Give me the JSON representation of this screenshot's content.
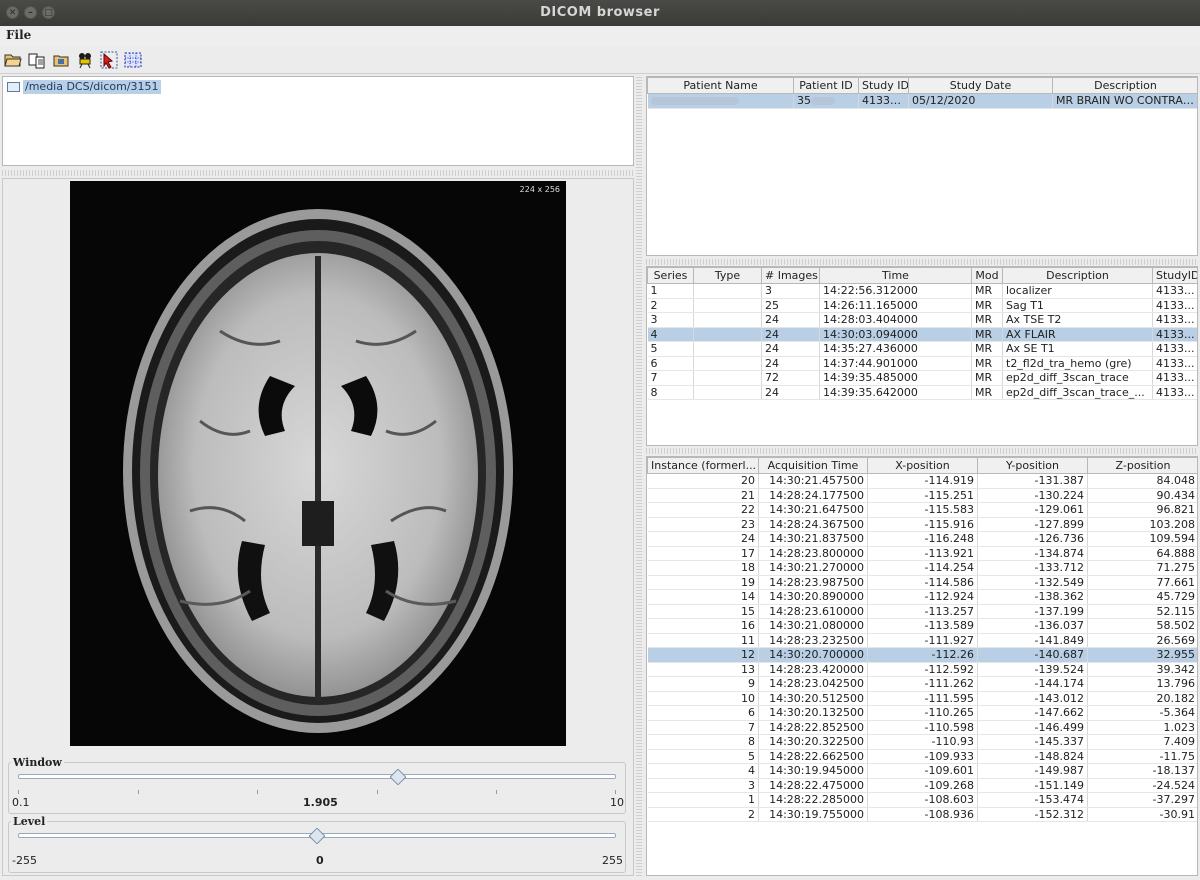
{
  "window": {
    "title": "DICOM browser"
  },
  "menu": {
    "file": "File"
  },
  "toolbar": {
    "icons": [
      "open-folder-icon",
      "copy-icon",
      "open-file-icon",
      "camera-icon",
      "select-icon",
      "select-region-icon"
    ]
  },
  "tree": {
    "path": "/media      DCS/dicom/3151"
  },
  "image": {
    "dims_label": "224 x 256"
  },
  "window_slider": {
    "label": "Window",
    "min": "0.1",
    "value": "1.905",
    "max": "10",
    "fraction": 0.635
  },
  "level_slider": {
    "label": "Level",
    "min": "-255",
    "value": "0",
    "max": "255",
    "fraction": 0.5
  },
  "patients": {
    "columns": [
      "Patient Name",
      "Patient ID",
      "Study ID",
      "Study Date",
      "Description"
    ],
    "rows": [
      [
        "",
        "35",
        "41331...",
        "05/12/2020",
        "MR BRAIN WO CONTRAST"
      ]
    ]
  },
  "series": {
    "columns": [
      "Series",
      "Type",
      "# Images",
      "Time",
      "Mod",
      "Description",
      "StudyID"
    ],
    "selected": 3,
    "rows": [
      [
        "1",
        "",
        "3",
        "14:22:56.312000",
        "MR",
        "localizer",
        "4133..."
      ],
      [
        "2",
        "",
        "25",
        "14:26:11.165000",
        "MR",
        "Sag T1",
        "4133..."
      ],
      [
        "3",
        "",
        "24",
        "14:28:03.404000",
        "MR",
        "Ax TSE T2",
        "4133..."
      ],
      [
        "4",
        "",
        "24",
        "14:30:03.094000",
        "MR",
        "AX FLAIR",
        "4133..."
      ],
      [
        "5",
        "",
        "24",
        "14:35:27.436000",
        "MR",
        "Ax SE T1",
        "4133..."
      ],
      [
        "6",
        "",
        "24",
        "14:37:44.901000",
        "MR",
        "t2_fl2d_tra_hemo (gre)",
        "4133..."
      ],
      [
        "7",
        "",
        "72",
        "14:39:35.485000",
        "MR",
        "ep2d_diff_3scan_trace",
        "4133..."
      ],
      [
        "8",
        "",
        "24",
        "14:39:35.642000",
        "MR",
        "ep2d_diff_3scan_trace_...",
        "4133..."
      ]
    ]
  },
  "instances": {
    "columns": [
      "Instance (formerl...",
      "Acquisition Time",
      "X-position",
      "Y-position",
      "Z-position"
    ],
    "selected": 12,
    "rows": [
      [
        "20",
        "14:30:21.457500",
        "-114.919",
        "-131.387",
        "84.048"
      ],
      [
        "21",
        "14:28:24.177500",
        "-115.251",
        "-130.224",
        "90.434"
      ],
      [
        "22",
        "14:30:21.647500",
        "-115.583",
        "-129.061",
        "96.821"
      ],
      [
        "23",
        "14:28:24.367500",
        "-115.916",
        "-127.899",
        "103.208"
      ],
      [
        "24",
        "14:30:21.837500",
        "-116.248",
        "-126.736",
        "109.594"
      ],
      [
        "17",
        "14:28:23.800000",
        "-113.921",
        "-134.874",
        "64.888"
      ],
      [
        "18",
        "14:30:21.270000",
        "-114.254",
        "-133.712",
        "71.275"
      ],
      [
        "19",
        "14:28:23.987500",
        "-114.586",
        "-132.549",
        "77.661"
      ],
      [
        "14",
        "14:30:20.890000",
        "-112.924",
        "-138.362",
        "45.729"
      ],
      [
        "15",
        "14:28:23.610000",
        "-113.257",
        "-137.199",
        "52.115"
      ],
      [
        "16",
        "14:30:21.080000",
        "-113.589",
        "-136.037",
        "58.502"
      ],
      [
        "11",
        "14:28:23.232500",
        "-111.927",
        "-141.849",
        "26.569"
      ],
      [
        "12",
        "14:30:20.700000",
        "-112.26",
        "-140.687",
        "32.955"
      ],
      [
        "13",
        "14:28:23.420000",
        "-112.592",
        "-139.524",
        "39.342"
      ],
      [
        "9",
        "14:28:23.042500",
        "-111.262",
        "-144.174",
        "13.796"
      ],
      [
        "10",
        "14:30:20.512500",
        "-111.595",
        "-143.012",
        "20.182"
      ],
      [
        "6",
        "14:30:20.132500",
        "-110.265",
        "-147.662",
        "-5.364"
      ],
      [
        "7",
        "14:28:22.852500",
        "-110.598",
        "-146.499",
        "1.023"
      ],
      [
        "8",
        "14:30:20.322500",
        "-110.93",
        "-145.337",
        "7.409"
      ],
      [
        "5",
        "14:28:22.662500",
        "-109.933",
        "-148.824",
        "-11.75"
      ],
      [
        "4",
        "14:30:19.945000",
        "-109.601",
        "-149.987",
        "-18.137"
      ],
      [
        "3",
        "14:28:22.475000",
        "-109.268",
        "-151.149",
        "-24.524"
      ],
      [
        "1",
        "14:28:22.285000",
        "-108.603",
        "-153.474",
        "-37.297"
      ],
      [
        "2",
        "14:30:19.755000",
        "-108.936",
        "-152.312",
        "-30.91"
      ]
    ]
  }
}
